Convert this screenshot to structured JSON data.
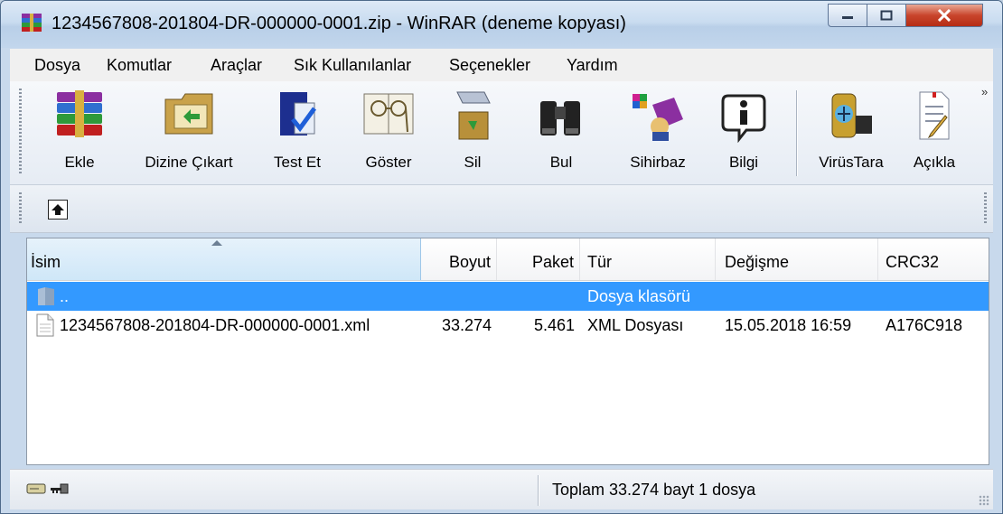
{
  "window": {
    "title": "1234567808-201804-DR-000000-0001.zip - WinRAR (deneme kopyası)",
    "app_icon": "winrar-books-icon",
    "caption_buttons": [
      "minimize",
      "maximize",
      "close"
    ]
  },
  "menu": {
    "items": [
      {
        "label": "Dosya",
        "accel": "D"
      },
      {
        "label": "Komutlar",
        "accel": "K"
      },
      {
        "label": "Araçlar",
        "accel": "ç"
      },
      {
        "label": "Sık Kullanılanlar",
        "accel": "S"
      },
      {
        "label": "Seçenekler",
        "accel": "e"
      },
      {
        "label": "Yardım",
        "accel": "Y"
      }
    ]
  },
  "toolbar": {
    "buttons": [
      {
        "label": "Ekle",
        "icon": "add-books-icon"
      },
      {
        "label": "Dizine Çıkart",
        "icon": "extract-folder-icon"
      },
      {
        "label": "Test Et",
        "icon": "test-checkmark-icon"
      },
      {
        "label": "Göster",
        "icon": "view-glasses-icon"
      },
      {
        "label": "Sil",
        "icon": "delete-recycle-icon"
      },
      {
        "label": "Bul",
        "icon": "find-binoculars-icon"
      },
      {
        "label": "Sihirbaz",
        "icon": "wizard-icon"
      },
      {
        "label": "Bilgi",
        "icon": "info-icon"
      },
      {
        "label": "VirüsTara",
        "icon": "virus-scan-icon"
      },
      {
        "label": "Açıkla",
        "icon": "comment-icon"
      }
    ],
    "overflow": "»"
  },
  "address": {
    "up_icon": "up-one-level-icon"
  },
  "filelist": {
    "columns": [
      "İsim",
      "Boyut",
      "Paket",
      "Tür",
      "Değişme",
      "CRC32"
    ],
    "sorted_column": "İsim",
    "rows": [
      {
        "name": "..",
        "size": "",
        "packed": "",
        "type": "Dosya klasörü",
        "modified": "",
        "crc": "",
        "selected": true,
        "icon": "folder-icon"
      },
      {
        "name": "1234567808-201804-DR-000000-0001.xml",
        "size": "33.274",
        "packed": "5.461",
        "type": "XML Dosyası",
        "modified": "15.05.2018 16:59",
        "crc": "A176C918",
        "selected": false,
        "icon": "file-icon"
      }
    ]
  },
  "status": {
    "text": "Toplam 33.274 bayt 1 dosya",
    "icons": [
      "drive-icon",
      "key-icon"
    ]
  },
  "colors": {
    "selection": "#3399ff",
    "title_bar": "#c9dcf0",
    "close_button": "#c9452c"
  }
}
